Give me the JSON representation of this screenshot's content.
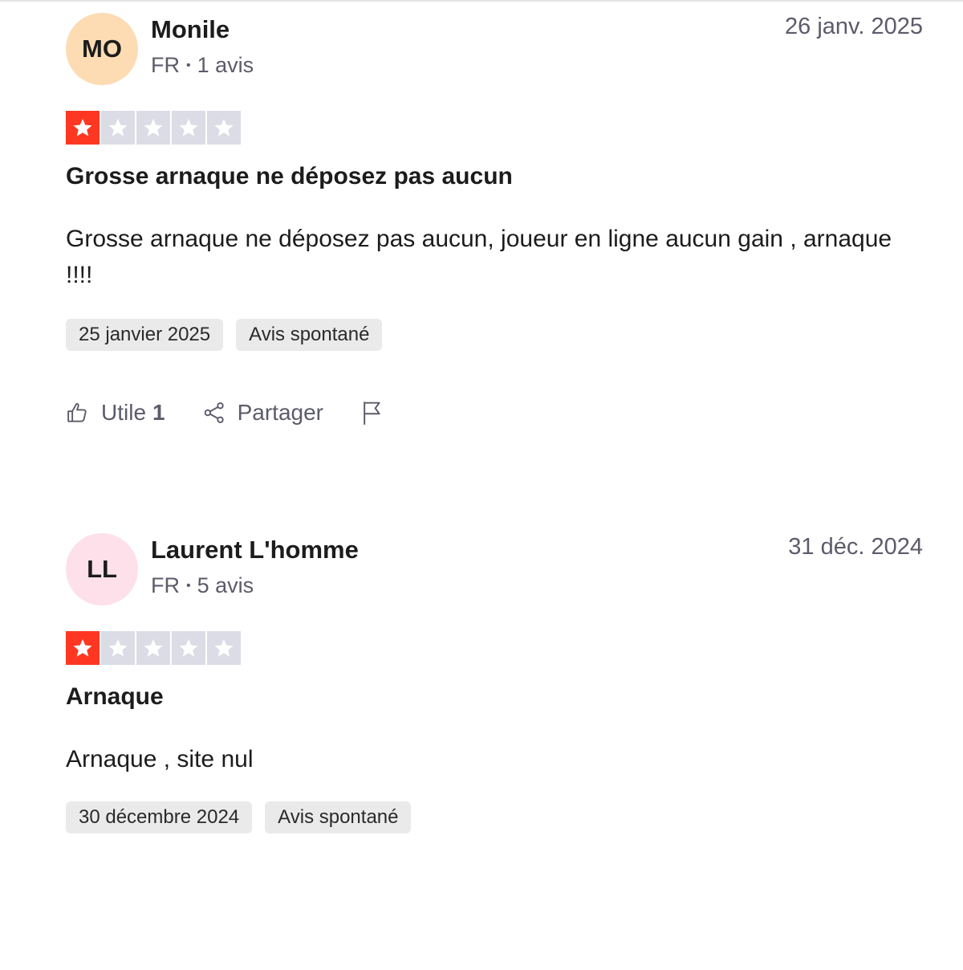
{
  "reviews": [
    {
      "initials": "MO",
      "avatar_color": "#fddcb4",
      "name": "Monile",
      "country": "FR",
      "review_count": "1 avis",
      "date": "26 janv. 2025",
      "rating": 1,
      "max_rating": 5,
      "title": "Grosse arnaque ne déposez pas aucun",
      "body": "Grosse arnaque ne déposez pas aucun, joueur en ligne aucun gain , arnaque !!!!",
      "experience_date": "25 janvier 2025",
      "tag": "Avis spontané",
      "useful_label": "Utile",
      "useful_count": "1",
      "share_label": "Partager"
    },
    {
      "initials": "LL",
      "avatar_color": "#fde0ea",
      "name": "Laurent L'homme",
      "country": "FR",
      "review_count": "5 avis",
      "date": "31 déc. 2024",
      "rating": 1,
      "max_rating": 5,
      "title": "Arnaque",
      "body": "Arnaque , site nul",
      "experience_date": "30 décembre 2024",
      "tag": "Avis spontané"
    }
  ],
  "colors": {
    "star_on": "#ff3722",
    "star_off": "#dcdce6"
  }
}
